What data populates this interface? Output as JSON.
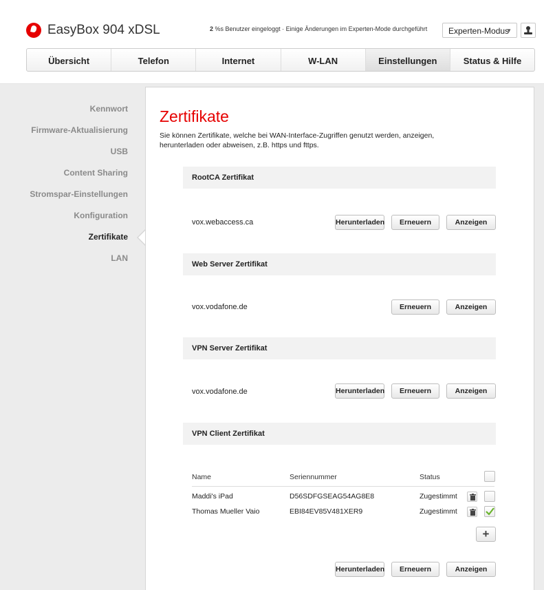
{
  "header": {
    "brand": "EasyBox 904 xDSL",
    "status_count": "2",
    "status_rest": " %s Benutzer eingeloggt · Einige Änderungen im Experten-Mode durchgeführt",
    "mode": "Experten-Modus",
    "icons": {
      "logo": "vodafone-logo",
      "user": "user-icon",
      "chevron": "chevron-down-icon"
    }
  },
  "nav": {
    "tabs": [
      "Übersicht",
      "Telefon",
      "Internet",
      "W-LAN",
      "Einstellungen",
      "Status & Hilfe"
    ],
    "active": "Einstellungen"
  },
  "sidebar": {
    "items": [
      "Kennwort",
      "Firmware-Aktualisierung",
      "USB",
      "Content Sharing",
      "Stromspar-Einstellungen",
      "Konfiguration",
      "Zertifikate",
      "LAN"
    ],
    "active": "Zertifikate"
  },
  "main": {
    "title": "Zertifikate",
    "intro": "Sie können Zertifikate, welche bei WAN-Interface-Zugriffen genutzt werden, anzeigen, herunterladen oder abweisen, z.B. https und fttps.",
    "sections": [
      {
        "title": "RootCA Zertifikat",
        "value": "vox.webaccess.ca"
      },
      {
        "title": "Web Server Zertifikat",
        "value": "vox.vodafone.de"
      },
      {
        "title": "VPN Server Zertifikat",
        "value": "vox.vodafone.de"
      },
      {
        "title": "VPN Client Zertifikat"
      }
    ],
    "buttons": {
      "download": "Herunterladen",
      "renew": "Erneuern",
      "show": "Anzeigen"
    },
    "client_table": {
      "headers": [
        "Name",
        "Seriennummer",
        "Status"
      ],
      "rows": [
        {
          "name": "Maddi's iPad",
          "serial": "D56SDFGSEAG54AG8E8",
          "status": "Zugestimmt",
          "checked": false
        },
        {
          "name": "Thomas Mueller Vaio",
          "serial": "EBI84EV85V481XER9",
          "status": "Zugestimmt",
          "checked": true
        }
      ],
      "add_label": "+"
    },
    "accent_color": "#e60000"
  }
}
